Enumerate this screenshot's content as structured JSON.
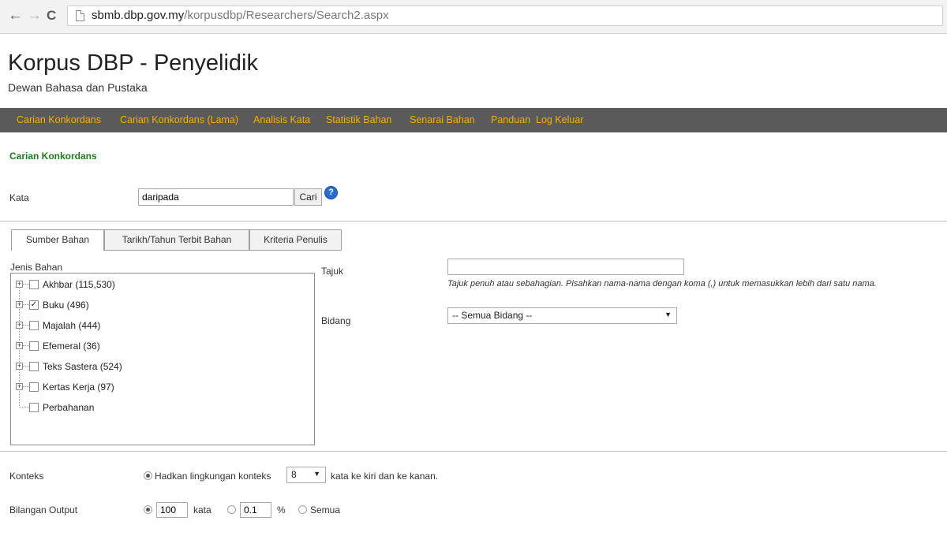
{
  "browser": {
    "back_glyph": "←",
    "forward_glyph": "→",
    "reload_glyph": "C",
    "url_host": "sbmb.dbp.gov.my",
    "url_path": "/korpusdbp/Researchers/Search2.aspx"
  },
  "header": {
    "title": "Korpus DBP - Penyelidik",
    "subtitle": "Dewan Bahasa dan Pustaka"
  },
  "menu": {
    "items": [
      "Carian Konkordans",
      "Carian Konkordans (Lama)",
      "Analisis Kata",
      "Statistik Bahan",
      "Senarai Bahan",
      "Panduan",
      "Log Keluar"
    ],
    "color": "#f5b000",
    "bar_color": "#5a5a5a"
  },
  "section_title": "Carian Konkordans",
  "search": {
    "label": "Kata",
    "value": "daripada",
    "button": "Cari",
    "help_glyph": "?"
  },
  "tabs": [
    "Sumber Bahan",
    "Tarikh/Tahun Terbit Bahan",
    "Kriteria Penulis"
  ],
  "tree": {
    "label": "Jenis Bahan",
    "items": [
      {
        "label": "Akhbar (115,530)",
        "checked": false,
        "expander": "+"
      },
      {
        "label": "Buku (496)",
        "checked": true,
        "expander": "+"
      },
      {
        "label": "Majalah (444)",
        "checked": false,
        "expander": "+"
      },
      {
        "label": "Efemeral (36)",
        "checked": false,
        "expander": "+"
      },
      {
        "label": "Teks Sastera (524)",
        "checked": false,
        "expander": "+"
      },
      {
        "label": "Kertas Kerja (97)",
        "checked": false,
        "expander": "+"
      },
      {
        "label": "Perbahanan",
        "checked": false,
        "expander": ""
      }
    ],
    "check_glyph": "✓"
  },
  "tajuk": {
    "label": "Tajuk",
    "value": "",
    "hint": "Tajuk penuh atau sebahagian. Pisahkan nama-nama dengan koma (,) untuk memasukkan lebih dari satu nama."
  },
  "bidang": {
    "label": "Bidang",
    "selected": "-- Semua Bidang --",
    "caret": "▼"
  },
  "konteks": {
    "label": "Konteks",
    "option_label": "Hadkan lingkungan konteks",
    "value": "8",
    "caret": "▼",
    "suffix": "kata ke kiri dan ke kanan."
  },
  "output": {
    "label": "Bilangan Output",
    "kata_value": "100",
    "kata_unit": "kata",
    "percent_value": "0.1",
    "percent_unit": "%",
    "semua_label": "Semua"
  },
  "colors": {
    "section_title": "#1f7a1f",
    "help_icon": "#2a6bd0"
  }
}
